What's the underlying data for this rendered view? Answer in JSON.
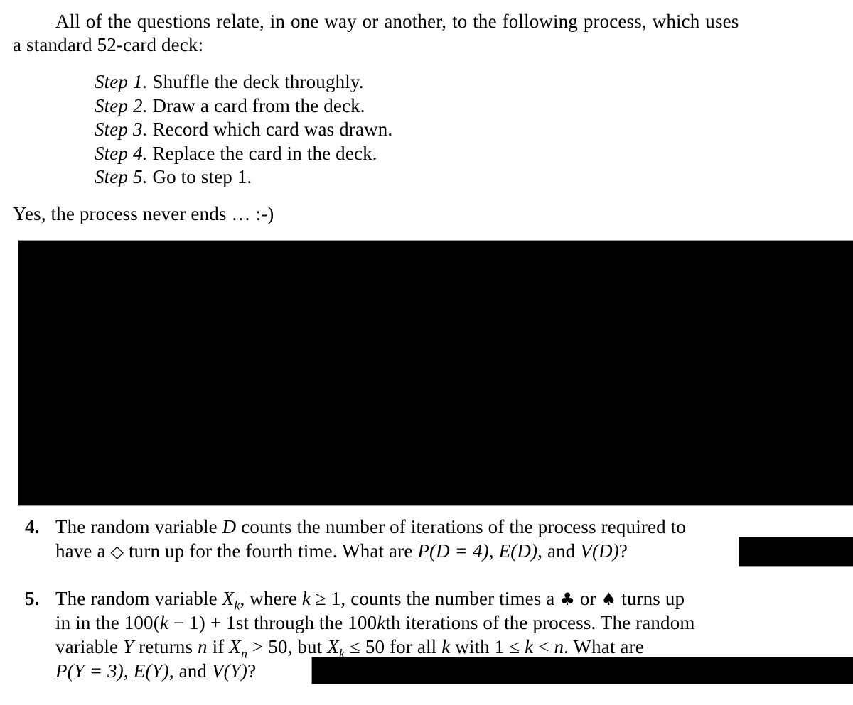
{
  "intro": {
    "line1": "All of the questions relate, in one way or another, to the following process, which uses",
    "line2": "a standard 52-card deck:"
  },
  "steps": [
    {
      "label": "Step 1.",
      "text": "Shuffle the deck throughly."
    },
    {
      "label": "Step 2.",
      "text": "Draw a card from the deck."
    },
    {
      "label": "Step 3.",
      "text": "Record which card was drawn."
    },
    {
      "label": "Step 4.",
      "text": "Replace the card in the deck."
    },
    {
      "label": "Step 5.",
      "text": "Go to step 1."
    }
  ],
  "closing": "Yes, the process never ends … :-)",
  "questions": [
    {
      "number": "4.",
      "lines": [
        {
          "parts": [
            "The random variable ",
            "D",
            " counts the number of iterations of the process required to"
          ]
        },
        {
          "parts": [
            "have a ",
            "◇",
            " turn up for the fourth time. What are ",
            "P(D = 4)",
            ", ",
            "E(D)",
            ", and ",
            "V(D)",
            "?"
          ]
        }
      ],
      "diamond_icon": "diamond-outline-icon"
    },
    {
      "number": "5.",
      "lines": [
        {
          "parts": [
            "The random variable ",
            "X",
            "k",
            ", where ",
            "k",
            " ≥ 1, counts the number times a ",
            "♣",
            " or ",
            "♠",
            " turns up"
          ]
        },
        {
          "parts": [
            "in in the 100(",
            "k",
            " − 1) + 1st through the 100",
            "k",
            "th iterations of the process. The random"
          ]
        },
        {
          "parts": [
            "variable ",
            "Y",
            " returns ",
            "n",
            " if ",
            "X",
            "n",
            " > 50, but ",
            "X",
            "k",
            " ≤ 50 for all ",
            "k",
            " with 1 ≤ ",
            "k",
            " < ",
            "n",
            ". What are"
          ]
        },
        {
          "parts": [
            "P(Y = 3)",
            ", ",
            "E(Y)",
            ", and ",
            "V(Y)",
            "?"
          ]
        }
      ]
    }
  ],
  "redactions": {
    "main_block": "redacted",
    "q4_answer": "redacted",
    "q5_answer": "redacted"
  }
}
